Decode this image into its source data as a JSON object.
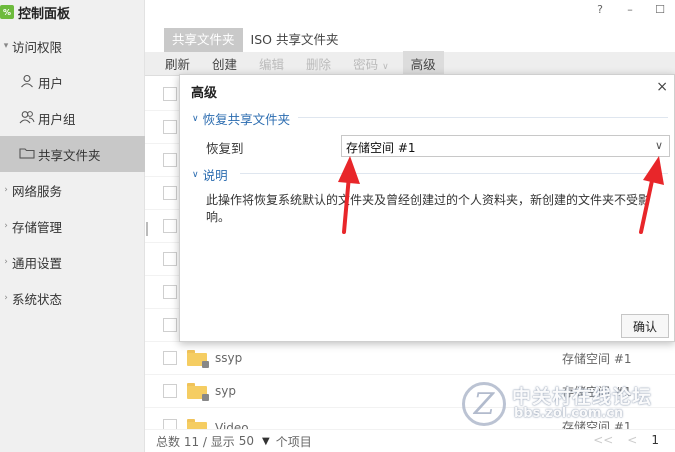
{
  "window": {
    "help": "?",
    "minimize": "–",
    "maximize": "☐"
  },
  "app": {
    "title": "控制面板",
    "logo_text": "%"
  },
  "sidebar": {
    "items": [
      {
        "label": "访问权限",
        "chevron": "▾"
      },
      {
        "label": "用户",
        "icon": "user-icon"
      },
      {
        "label": "用户组",
        "icon": "user-group-icon"
      },
      {
        "label": "共享文件夹",
        "icon": "shared-folder-icon"
      },
      {
        "label": "网络服务",
        "chevron": "›"
      },
      {
        "label": "存储管理",
        "chevron": "›"
      },
      {
        "label": "通用设置",
        "chevron": "›"
      },
      {
        "label": "系统状态",
        "chevron": "›"
      }
    ]
  },
  "tabs": [
    {
      "label": "共享文件夹"
    },
    {
      "label": "ISO 共享文件夹"
    }
  ],
  "toolbar": {
    "refresh": "刷新",
    "create": "创建",
    "edit": "编辑",
    "delete": "删除",
    "permission": "密码",
    "advanced": "高级",
    "dropdown": "∨"
  },
  "list": {
    "rows": [
      {
        "name": "",
        "volume": ""
      },
      {
        "name": "",
        "volume": ""
      },
      {
        "name": "",
        "volume": ""
      },
      {
        "name": "",
        "volume": ""
      },
      {
        "name": "",
        "volume": ""
      },
      {
        "name": "",
        "volume": ""
      },
      {
        "name": "",
        "volume": ""
      },
      {
        "name": "",
        "volume": ""
      },
      {
        "name": "ssyp",
        "volume": "存储空间 #1"
      },
      {
        "name": "syp",
        "volume": "存储空间 #1"
      },
      {
        "name": "Video",
        "volume": "存储空间 #1"
      }
    ]
  },
  "footer": {
    "total": "总数 11 / 显示",
    "page_size": "50",
    "caret": "▼",
    "unit": "个项目",
    "first": "<<",
    "prev": "<",
    "page": "1"
  },
  "dialog": {
    "title": "高级",
    "close": "×",
    "section_restore": "恢复共享文件夹",
    "restore_to_label": "恢复到",
    "restore_to_value": "存储空间 #1",
    "select_arrow": "∨",
    "section_notes": "说明",
    "description": "此操作将恢复系统默认的文件夹及曾经创建过的个人资料夹，新创建的文件夹不受影响。",
    "ok": "确认"
  },
  "watermark": {
    "logo_char": "Z",
    "title": "中关村在线论坛",
    "url": "bbs.zol.com.cn"
  },
  "colors": {
    "sidebar_bg": "#f0f0f0",
    "active_nav": "#c8c8c8",
    "section_blue": "#2b6cb0",
    "folder_yellow": "#f5cd62",
    "arrow_red": "#e8262a"
  }
}
